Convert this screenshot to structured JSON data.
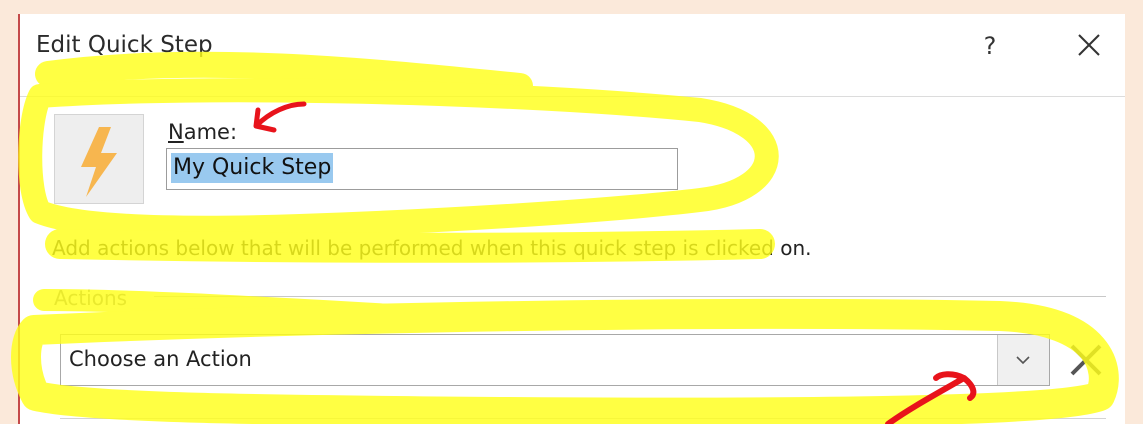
{
  "dialog": {
    "title": "Edit Quick Step",
    "help_label": "?",
    "close_icon": "close-icon"
  },
  "name": {
    "label_accel": "N",
    "label_rest": "ame:",
    "value": "My Quick Step",
    "icon": "lightning-bolt-icon"
  },
  "description": "Add actions below that will be performed when this quick step is clicked on.",
  "actions": {
    "section_label": "Actions",
    "selected_action": "Choose an Action",
    "dropdown_icon": "chevron-down-icon",
    "remove_icon": "remove-action-icon"
  },
  "annotations": {
    "highlight_color": "#ffff1a",
    "arrow_color": "#e8131b"
  }
}
